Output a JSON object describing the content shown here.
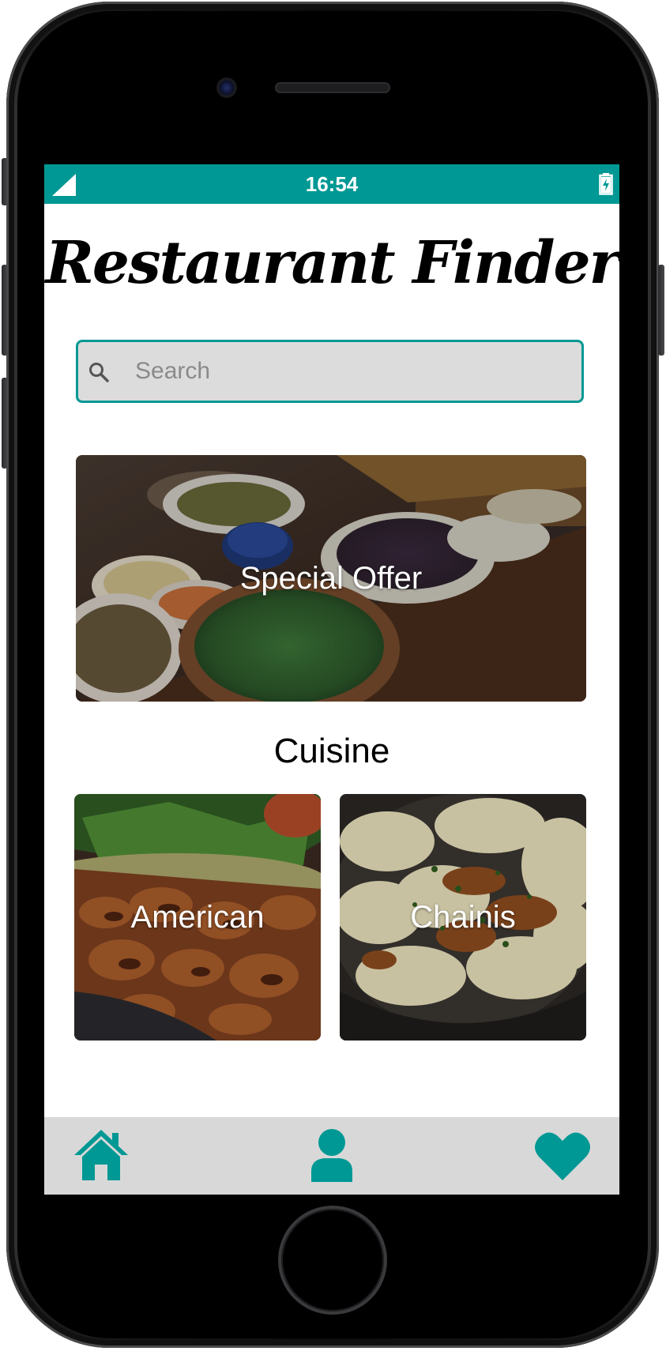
{
  "colors": {
    "accent": "#009894",
    "status_bar": "#009894",
    "search_background": "#dcdcdc",
    "nav_background": "#d8d8d8",
    "nav_icon": "#009894"
  },
  "status_bar": {
    "time": "16:54",
    "signal_icon": "signal-icon",
    "battery_icon": "battery-charging-icon"
  },
  "header": {
    "title": "Restaurant Finder"
  },
  "search": {
    "placeholder": "Search",
    "value": "",
    "icon": "search-icon"
  },
  "special_offer": {
    "label": "Special Offer"
  },
  "cuisine": {
    "section_title": "Cuisine",
    "items": [
      {
        "label": "American"
      },
      {
        "label": "Chainis"
      }
    ]
  },
  "bottom_nav": {
    "items": [
      {
        "icon": "home-icon"
      },
      {
        "icon": "user-icon"
      },
      {
        "icon": "heart-icon"
      }
    ]
  }
}
